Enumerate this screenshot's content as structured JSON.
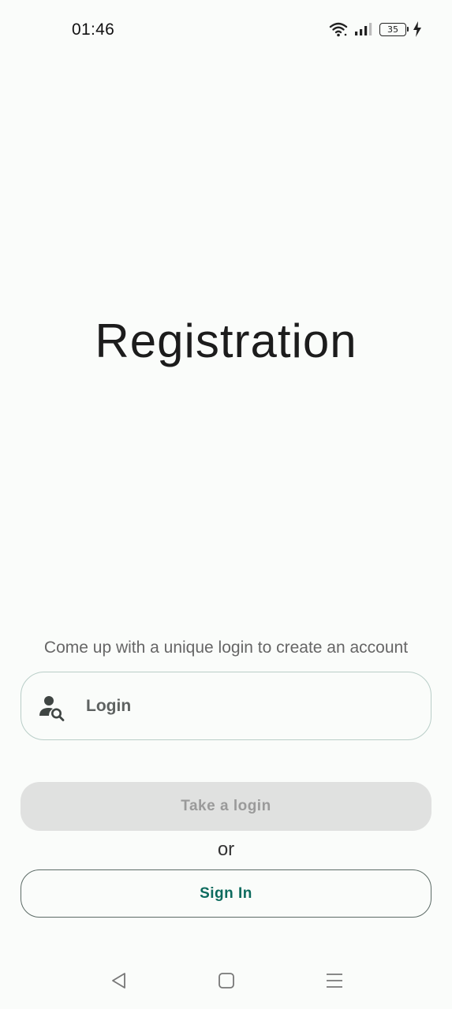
{
  "status_bar": {
    "time": "01:46",
    "battery_level": "35",
    "icons": [
      "wifi-icon",
      "signal-icon",
      "battery-icon",
      "charging-icon"
    ]
  },
  "page": {
    "title": "Registration",
    "helper_text": "Come up with a unique login to create an account"
  },
  "login_field": {
    "placeholder": "Login",
    "value": "",
    "icon": "user-search-icon"
  },
  "buttons": {
    "take_login": "Take a login",
    "or": "or",
    "sign_in": "Sign In"
  },
  "colors": {
    "background": "#fafcfa",
    "field_border": "#b9cec8",
    "disabled_button_bg": "#e0e1e0",
    "disabled_button_text": "#9a9a9a",
    "accent_text": "#0d6b5e",
    "outline_border": "#5c6b66"
  },
  "nav_bar": {
    "icons": [
      "back-icon",
      "home-icon",
      "menu-icon"
    ]
  }
}
